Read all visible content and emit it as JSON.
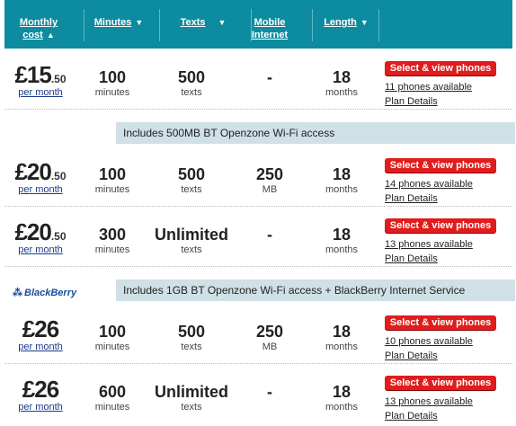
{
  "header": {
    "monthly_cost": "Monthly cost",
    "minutes": "Minutes",
    "texts": "Texts",
    "mobile_internet": "Mobile Internet",
    "length": "Length",
    "sort_up_icon": "▲",
    "sort_down_icon": "▼"
  },
  "plans": [
    {
      "price": "£15",
      "decimal": ".50",
      "per": "per month",
      "minutes": "100",
      "minutes_unit": "minutes",
      "texts": "500",
      "texts_unit": "texts",
      "internet": "-",
      "internet_unit": "",
      "length": "18",
      "length_unit": "months",
      "select": "Select & view phones",
      "available": "11 phones available",
      "details": "Plan Details"
    },
    {
      "price": "£20",
      "decimal": ".50",
      "per": "per month",
      "minutes": "100",
      "minutes_unit": "minutes",
      "texts": "500",
      "texts_unit": "texts",
      "internet": "250",
      "internet_unit": "MB",
      "length": "18",
      "length_unit": "months",
      "select": "Select & view phones",
      "available": "14 phones available",
      "details": "Plan Details"
    },
    {
      "price": "£20",
      "decimal": ".50",
      "per": "per month",
      "minutes": "300",
      "minutes_unit": "minutes",
      "texts": "Unlimited",
      "texts_unit": "texts",
      "internet": "-",
      "internet_unit": "",
      "length": "18",
      "length_unit": "months",
      "select": "Select & view phones",
      "available": "13 phones available",
      "details": "Plan Details"
    },
    {
      "price": "£26",
      "decimal": "",
      "per": "per month",
      "minutes": "100",
      "minutes_unit": "minutes",
      "texts": "500",
      "texts_unit": "texts",
      "internet": "250",
      "internet_unit": "MB",
      "length": "18",
      "length_unit": "months",
      "select": "Select & view phones",
      "available": "10 phones available",
      "details": "Plan Details"
    },
    {
      "price": "£26",
      "decimal": "",
      "per": "per month",
      "minutes": "600",
      "minutes_unit": "minutes",
      "texts": "Unlimited",
      "texts_unit": "texts",
      "internet": "-",
      "internet_unit": "",
      "length": "18",
      "length_unit": "months",
      "select": "Select & view phones",
      "available": "13 phones available",
      "details": "Plan Details"
    }
  ],
  "bands": {
    "wifi_500": "Includes 500MB BT Openzone Wi-Fi access",
    "wifi_1gb": "Includes 1GB BT Openzone Wi-Fi access + BlackBerry Internet Service"
  },
  "blackberry_logo": "BlackBerry",
  "colors": {
    "header": "#0d8ba0",
    "select_button": "#e01c1c",
    "band": "#cfe0e6",
    "link": "#1a3a8a"
  }
}
